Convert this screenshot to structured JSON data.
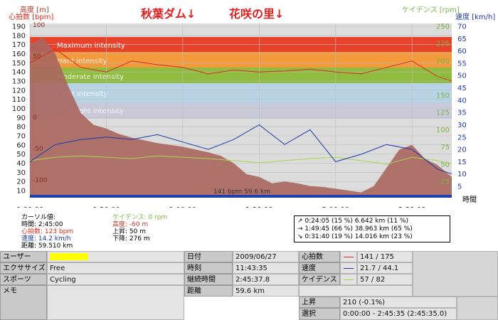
{
  "annotations": {
    "left": "秋葉ダム↓",
    "right": "花咲の里↓"
  },
  "axes": {
    "altitude_label": "高度 [m]",
    "heart_label": "心拍数 [bpm]",
    "cadence_label": "ケイデンス [rpm]",
    "speed_label": "速度 [km/h]",
    "time_label": "時間",
    "altitude_ticks": [
      "190",
      "180",
      "170",
      "160",
      "150",
      "140",
      "130",
      "120",
      "110",
      "100",
      "90",
      "80",
      "70",
      "60",
      "50",
      "40",
      "30",
      "20",
      "10"
    ],
    "heart_ticks": [
      "100",
      "50",
      "0",
      "-50",
      "-100"
    ],
    "cadence_ticks": [
      "250",
      "225",
      "200",
      "175",
      "150",
      "125",
      "100",
      "75",
      "50",
      "25"
    ],
    "speed_ticks": [
      "70",
      "65",
      "60",
      "55",
      "50",
      "45",
      "40",
      "35",
      "30",
      "25",
      "20",
      "15",
      "10",
      "5"
    ],
    "time_ticks": [
      "0:00:00",
      "0:30:00",
      "1:00:00",
      "1:30:00",
      "2:00:00",
      "2:30:00"
    ]
  },
  "zones": {
    "maximum": "Maximum intensity",
    "hard": "Hard intensity",
    "moderate": "Moderate intensity",
    "light": "Light intensity",
    "very_light": "Very light intensity"
  },
  "colors": {
    "plot_bg": "#dcdcdc",
    "zone_max": "#e8432a",
    "zone_hard": "#f29a3c",
    "zone_moderate": "#8fbc3f",
    "zone_light": "#b9d3e6",
    "zone_very_light": "#c9c9d9",
    "altitude_fill": "#a8665e",
    "heart": "#e02a1a",
    "speed": "#1c3aa8",
    "cadence": "#a4d84c",
    "baseline": "#1f3fae"
  },
  "chart_data": {
    "type": "line",
    "x_unit": "h:mm:ss",
    "x_range": [
      "0:00:00",
      "2:45:35"
    ],
    "series": [
      {
        "name": "高度 [m]",
        "unit": "m",
        "x": [
          "0:00:00",
          "0:05:00",
          "0:10:00",
          "0:15:00",
          "0:20:00",
          "0:25:00",
          "0:30:00",
          "0:35:00",
          "0:40:00",
          "0:45:00",
          "0:50:00",
          "0:55:00",
          "1:00:00",
          "1:05:00",
          "1:10:00",
          "1:15:00",
          "1:20:00",
          "1:25:00",
          "1:30:00",
          "1:35:00",
          "1:40:00",
          "1:45:00",
          "1:50:00",
          "1:55:00",
          "2:00:00",
          "2:05:00",
          "2:10:00",
          "2:15:00",
          "2:20:00",
          "2:25:00",
          "2:30:00",
          "2:35:00",
          "2:40:00",
          "2:45:35"
        ],
        "values": [
          170,
          178,
          160,
          125,
          95,
          82,
          78,
          72,
          68,
          65,
          62,
          60,
          58,
          55,
          52,
          48,
          40,
          28,
          25,
          18,
          20,
          18,
          15,
          14,
          12,
          10,
          8,
          15,
          35,
          55,
          60,
          45,
          38,
          25
        ]
      },
      {
        "name": "心拍数 [bpm]",
        "unit": "bpm",
        "x": [
          "0:00:00",
          "0:10:00",
          "0:20:00",
          "0:30:00",
          "0:40:00",
          "0:50:00",
          "1:00:00",
          "1:10:00",
          "1:20:00",
          "1:30:00",
          "1:40:00",
          "1:50:00",
          "2:00:00",
          "2:10:00",
          "2:20:00",
          "2:30:00",
          "2:40:00",
          "2:45:35"
        ],
        "values": [
          150,
          165,
          145,
          140,
          152,
          148,
          145,
          138,
          142,
          140,
          141,
          143,
          140,
          138,
          145,
          152,
          135,
          130
        ]
      },
      {
        "name": "速度 [km/h]",
        "unit": "km/h",
        "x": [
          "0:00:00",
          "0:10:00",
          "0:20:00",
          "0:30:00",
          "0:40:00",
          "0:50:00",
          "1:00:00",
          "1:10:00",
          "1:20:00",
          "1:30:00",
          "1:40:00",
          "1:50:00",
          "2:00:00",
          "2:10:00",
          "2:20:00",
          "2:30:00",
          "2:40:00",
          "2:45:35"
        ],
        "values": [
          15,
          22,
          24,
          25,
          24,
          26,
          23,
          20,
          24,
          30,
          22,
          28,
          15,
          18,
          22,
          20,
          12,
          10
        ]
      },
      {
        "name": "ケイデンス [rpm]",
        "unit": "rpm",
        "x": [
          "0:00:00",
          "0:10:00",
          "0:20:00",
          "0:30:00",
          "0:40:00",
          "0:50:00",
          "1:00:00",
          "1:10:00",
          "1:20:00",
          "1:30:00",
          "1:40:00",
          "1:50:00",
          "2:00:00",
          "2:10:00",
          "2:20:00",
          "2:30:00",
          "2:40:00",
          "2:45:35"
        ],
        "values": [
          55,
          60,
          62,
          60,
          58,
          62,
          60,
          58,
          55,
          52,
          55,
          58,
          60,
          55,
          50,
          60,
          55,
          50
        ]
      }
    ],
    "baseline_text": "141 bpm 59.6 km"
  },
  "cursor_info": {
    "label": "カーソル値:",
    "time": "時間: 2:45:00",
    "heart": "心拍数: 123 bpm",
    "speed": "速度: 14.2 km/h",
    "distance": "距離: 59.510 km",
    "cadence": "ケイデンス: 0 rpm",
    "altitude": "高度: -60 m",
    "ascent": "上昇: 50 m",
    "descent": "下降: 276 m"
  },
  "selection": {
    "rows": [
      "↗ 0:24:05  (15 %)  6.642 km  (11 %)",
      "→ 1:49:45  (66 %) 38.963 km  (65 %)",
      "↘ 0:31:40  (19 %) 14.016 km  (23 %)"
    ]
  },
  "table": {
    "user_label": "ユーザー",
    "exercise_label": "エクササイズ",
    "exercise_value": "Free",
    "sport_label": "スポーツ",
    "sport_value": "Cycling",
    "memo_label": "メモ",
    "date_label": "日付",
    "date_value": "2009/06/27",
    "time_label": "時刻",
    "time_value": "11:43:35",
    "duration_label": "継続時間",
    "duration_value": "2:45:37.8",
    "distance_label": "距離",
    "distance_value": "59.6 km",
    "hr_label": "心拍数",
    "hr_value": "141 / 175",
    "speed_label": "速度",
    "speed_value": "21.7 / 44.1",
    "cadence_label": "ケイデンス",
    "cadence_value": "57 / 82",
    "ascent_label": "上昇",
    "ascent_value": "210 (-0.1%)",
    "select_label": "選択",
    "select_value": "0:00:00 - 2:45:35 (2:45:35.0)"
  }
}
